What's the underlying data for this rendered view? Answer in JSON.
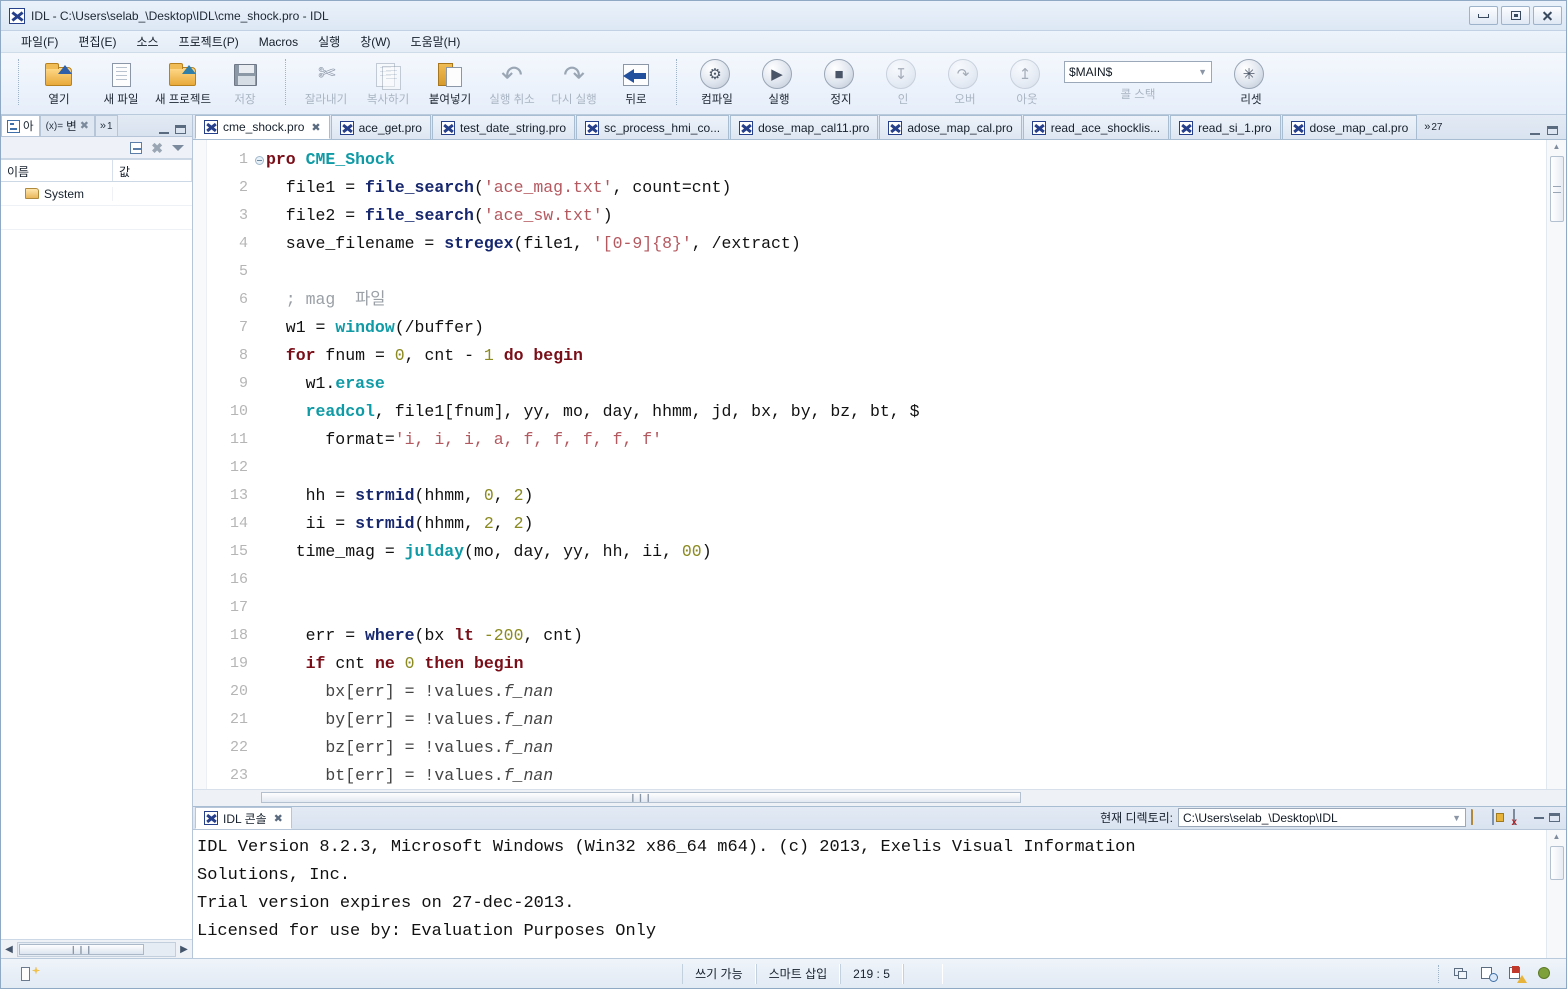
{
  "window": {
    "title": "IDL - C:\\Users\\selab_\\Desktop\\IDL\\cme_shock.pro - IDL",
    "app_icon": "idl-icon",
    "minimize": "minimize-icon",
    "restore": "restore-icon",
    "close": "close-icon"
  },
  "menubar": {
    "items": [
      {
        "label": "파일(F)"
      },
      {
        "label": "편집(E)"
      },
      {
        "label": "소스"
      },
      {
        "label": "프로젝트(P)"
      },
      {
        "label": "Macros"
      },
      {
        "label": "실행"
      },
      {
        "label": "창(W)"
      },
      {
        "label": "도움말(H)"
      }
    ]
  },
  "toolbar": {
    "file_group": [
      {
        "label": "열기",
        "icon": "folder-open-icon",
        "enabled": true
      },
      {
        "label": "새 파일",
        "icon": "new-file-icon",
        "enabled": true
      },
      {
        "label": "새 프로젝트",
        "icon": "new-project-icon",
        "enabled": true
      },
      {
        "label": "저장",
        "icon": "save-icon",
        "enabled": false
      }
    ],
    "edit_group": [
      {
        "label": "잘라내기",
        "icon": "cut-icon",
        "enabled": false
      },
      {
        "label": "복사하기",
        "icon": "copy-icon",
        "enabled": false
      },
      {
        "label": "붙여넣기",
        "icon": "paste-icon",
        "enabled": true
      },
      {
        "label": "실행 취소",
        "icon": "undo-icon",
        "enabled": false
      },
      {
        "label": "다시 실행",
        "icon": "redo-icon",
        "enabled": false
      },
      {
        "label": "뒤로",
        "icon": "back-icon",
        "enabled": true
      }
    ],
    "run_group": [
      {
        "label": "컴파일",
        "icon": "gear-icon",
        "glyph": "⚙",
        "enabled": true
      },
      {
        "label": "실행",
        "icon": "play-icon",
        "glyph": "▶",
        "enabled": true
      },
      {
        "label": "정지",
        "icon": "stop-icon",
        "glyph": "■",
        "enabled": true
      },
      {
        "label": "인",
        "icon": "step-into-icon",
        "glyph": "↧",
        "enabled": false
      },
      {
        "label": "오버",
        "icon": "step-over-icon",
        "glyph": "↷",
        "enabled": false
      },
      {
        "label": "아웃",
        "icon": "step-out-icon",
        "glyph": "↥",
        "enabled": false
      }
    ],
    "callstack": {
      "value": "$MAIN$",
      "label": "콜 스택",
      "dropdown_icon": "chevron-down-icon"
    },
    "reset": {
      "label": "리셋",
      "icon": "reset-icon",
      "glyph": "✳"
    }
  },
  "left_panel": {
    "tabs": [
      {
        "label": "아",
        "icon": "outline-icon",
        "active": true
      },
      {
        "label": "변",
        "icon": "variables-icon",
        "prefix": "(x)=",
        "active": false
      }
    ],
    "overflow": {
      "label": "1",
      "icon": "chevron-double-right-icon"
    },
    "window_controls": {
      "minimize": "minimize-icon",
      "maximize": "maximize-icon"
    },
    "tools": [
      {
        "icon": "collapse-all-icon"
      },
      {
        "icon": "close-icon"
      },
      {
        "icon": "view-menu-icon"
      }
    ],
    "columns": [
      "이름",
      "값"
    ],
    "rows": [
      {
        "name": "System",
        "value": "",
        "icon": "folder-icon"
      }
    ],
    "scrollbar": {
      "left_arrow": "◀",
      "right_arrow": "▶",
      "grip": "❙❙❙"
    }
  },
  "editor_tabs": {
    "tabs": [
      {
        "label": "cme_shock.pro",
        "active": true,
        "closable": true
      },
      {
        "label": "ace_get.pro",
        "active": false,
        "closable": false
      },
      {
        "label": "test_date_string.pro",
        "active": false,
        "closable": false
      },
      {
        "label": "sc_process_hmi_co...",
        "active": false,
        "closable": false
      },
      {
        "label": "dose_map_cal11.pro",
        "active": false,
        "closable": false
      },
      {
        "label": "adose_map_cal.pro",
        "active": false,
        "closable": false
      },
      {
        "label": "read_ace_shocklis...",
        "active": false,
        "closable": false
      },
      {
        "label": "read_si_1.pro",
        "active": false,
        "closable": false
      },
      {
        "label": "dose_map_cal.pro",
        "active": false,
        "closable": false
      }
    ],
    "overflow_count": "27",
    "overflow_icon": "chevron-double-right-icon",
    "window_controls": {
      "minimize": "minimize-icon",
      "maximize": "maximize-icon"
    }
  },
  "editor": {
    "filename": "cme_shock.pro",
    "lines": [
      {
        "n": "1",
        "fold": true,
        "tokens": [
          {
            "t": "pro ",
            "c": "kw"
          },
          {
            "t": "CME_Shock",
            "c": "proc"
          }
        ]
      },
      {
        "n": "2",
        "fold": false,
        "tokens": [
          {
            "t": "  file1 = ",
            "c": ""
          },
          {
            "t": "file_search",
            "c": "fn"
          },
          {
            "t": "(",
            "c": ""
          },
          {
            "t": "'ace_mag.txt'",
            "c": "str"
          },
          {
            "t": ", count=cnt)",
            "c": ""
          }
        ]
      },
      {
        "n": "3",
        "fold": false,
        "tokens": [
          {
            "t": "  file2 = ",
            "c": ""
          },
          {
            "t": "file_search",
            "c": "fn"
          },
          {
            "t": "(",
            "c": ""
          },
          {
            "t": "'ace_sw.txt'",
            "c": "str"
          },
          {
            "t": ")",
            "c": ""
          }
        ]
      },
      {
        "n": "4",
        "fold": false,
        "tokens": [
          {
            "t": "  save_filename = ",
            "c": ""
          },
          {
            "t": "stregex",
            "c": "fn"
          },
          {
            "t": "(file1, ",
            "c": ""
          },
          {
            "t": "'[0-9]{8}'",
            "c": "str"
          },
          {
            "t": ", /extract)",
            "c": ""
          }
        ]
      },
      {
        "n": "5",
        "fold": false,
        "tokens": [
          {
            "t": "",
            "c": ""
          }
        ]
      },
      {
        "n": "6",
        "fold": false,
        "tokens": [
          {
            "t": "  ; mag  파일",
            "c": "cmt"
          }
        ]
      },
      {
        "n": "7",
        "fold": false,
        "tokens": [
          {
            "t": "  w1 = ",
            "c": ""
          },
          {
            "t": "window",
            "c": "bif"
          },
          {
            "t": "(/buffer)",
            "c": ""
          }
        ]
      },
      {
        "n": "8",
        "fold": false,
        "tokens": [
          {
            "t": "  ",
            "c": ""
          },
          {
            "t": "for",
            "c": "kw"
          },
          {
            "t": " fnum = ",
            "c": ""
          },
          {
            "t": "0",
            "c": "num"
          },
          {
            "t": ", cnt - ",
            "c": ""
          },
          {
            "t": "1",
            "c": "num"
          },
          {
            "t": " ",
            "c": ""
          },
          {
            "t": "do begin",
            "c": "kw"
          }
        ]
      },
      {
        "n": "9",
        "fold": false,
        "tokens": [
          {
            "t": "    w1.",
            "c": ""
          },
          {
            "t": "erase",
            "c": "bif"
          }
        ]
      },
      {
        "n": "10",
        "fold": false,
        "tokens": [
          {
            "t": "    ",
            "c": ""
          },
          {
            "t": "readcol",
            "c": "bif"
          },
          {
            "t": ", file1[fnum], yy, mo, day, hhmm, jd, bx, by, bz, bt, $",
            "c": ""
          }
        ]
      },
      {
        "n": "11",
        "fold": false,
        "tokens": [
          {
            "t": "      format=",
            "c": ""
          },
          {
            "t": "'i, i, i, a, f, f, f, f, f'",
            "c": "str"
          }
        ]
      },
      {
        "n": "12",
        "fold": false,
        "tokens": [
          {
            "t": "",
            "c": ""
          }
        ]
      },
      {
        "n": "13",
        "fold": false,
        "tokens": [
          {
            "t": "    hh = ",
            "c": ""
          },
          {
            "t": "strmid",
            "c": "fn"
          },
          {
            "t": "(hhmm, ",
            "c": ""
          },
          {
            "t": "0",
            "c": "num"
          },
          {
            "t": ", ",
            "c": ""
          },
          {
            "t": "2",
            "c": "num"
          },
          {
            "t": ")",
            "c": ""
          }
        ]
      },
      {
        "n": "14",
        "fold": false,
        "tokens": [
          {
            "t": "    ii = ",
            "c": ""
          },
          {
            "t": "strmid",
            "c": "fn"
          },
          {
            "t": "(hhmm, ",
            "c": ""
          },
          {
            "t": "2",
            "c": "num"
          },
          {
            "t": ", ",
            "c": ""
          },
          {
            "t": "2",
            "c": "num"
          },
          {
            "t": ")",
            "c": ""
          }
        ]
      },
      {
        "n": "15",
        "fold": false,
        "tokens": [
          {
            "t": "   time_mag = ",
            "c": ""
          },
          {
            "t": "julday",
            "c": "bif"
          },
          {
            "t": "(mo, day, yy, hh, ii, ",
            "c": ""
          },
          {
            "t": "00",
            "c": "num"
          },
          {
            "t": ")",
            "c": ""
          }
        ]
      },
      {
        "n": "16",
        "fold": false,
        "tokens": [
          {
            "t": "",
            "c": ""
          }
        ]
      },
      {
        "n": "17",
        "fold": false,
        "tokens": [
          {
            "t": "",
            "c": ""
          }
        ]
      },
      {
        "n": "18",
        "fold": false,
        "tokens": [
          {
            "t": "    err = ",
            "c": ""
          },
          {
            "t": "where",
            "c": "fn"
          },
          {
            "t": "(bx ",
            "c": ""
          },
          {
            "t": "lt",
            "c": "kw"
          },
          {
            "t": " ",
            "c": ""
          },
          {
            "t": "-200",
            "c": "num"
          },
          {
            "t": ", cnt)",
            "c": ""
          }
        ]
      },
      {
        "n": "19",
        "fold": false,
        "tokens": [
          {
            "t": "    ",
            "c": ""
          },
          {
            "t": "if",
            "c": "kw"
          },
          {
            "t": " cnt ",
            "c": ""
          },
          {
            "t": "ne",
            "c": "kw"
          },
          {
            "t": " ",
            "c": ""
          },
          {
            "t": "0",
            "c": "num"
          },
          {
            "t": " ",
            "c": ""
          },
          {
            "t": "then begin",
            "c": "kw"
          }
        ]
      },
      {
        "n": "20",
        "fold": false,
        "tokens": [
          {
            "t": "      bx[err] = !values.",
            "c": "sysv"
          },
          {
            "t": "f_nan",
            "c": "sysv ital"
          }
        ]
      },
      {
        "n": "21",
        "fold": false,
        "tokens": [
          {
            "t": "      by[err] = !values.",
            "c": "sysv"
          },
          {
            "t": "f_nan",
            "c": "sysv ital"
          }
        ]
      },
      {
        "n": "22",
        "fold": false,
        "tokens": [
          {
            "t": "      bz[err] = !values.",
            "c": "sysv"
          },
          {
            "t": "f_nan",
            "c": "sysv ital"
          }
        ]
      },
      {
        "n": "23",
        "fold": false,
        "tokens": [
          {
            "t": "      bt[err] = !values.",
            "c": "sysv"
          },
          {
            "t": "f_nan",
            "c": "sysv ital"
          }
        ]
      }
    ],
    "vscroll": {
      "up_arrow": "▲"
    },
    "hscroll": {
      "grip": "❙❙❙"
    }
  },
  "console": {
    "tab_label": "IDL 콘솔",
    "tab_icon": "idl-icon",
    "tab_close": "close-icon",
    "dir_label": "현재 디렉토리:",
    "dir_value": "C:\\Users\\selab_\\Desktop\\IDL",
    "dir_dropdown_icon": "chevron-down-icon",
    "buttons": [
      {
        "icon": "open-folder-icon"
      },
      {
        "icon": "lock-scroll-icon"
      },
      {
        "icon": "clear-console-icon"
      }
    ],
    "window_controls": {
      "minimize": "minimize-icon",
      "maximize": "maximize-icon"
    },
    "output": "IDL Version 8.2.3, Microsoft Windows (Win32 x86_64 m64). (c) 2013, Exelis Visual Information\nSolutions, Inc.\nTrial version expires on 27-dec-2013.\nLicensed for use by: Evaluation Purposes Only"
  },
  "statusbar": {
    "left_icon": "writable-doc-icon",
    "sections": [
      {
        "label": "쓰기 가능"
      },
      {
        "label": "스마트 삽입"
      },
      {
        "label": "219 : 5"
      }
    ],
    "right_icons": [
      {
        "icon": "tile-windows-icon"
      },
      {
        "icon": "build-history-icon"
      },
      {
        "icon": "problems-icon"
      },
      {
        "icon": "debug-icon"
      }
    ]
  },
  "colors": {
    "keyword": "#7a0e18",
    "function": "#16276e",
    "builtin": "#0f9ba6",
    "string": "#b4585f",
    "number": "#8a8a20",
    "comment": "#9aa0a6",
    "chrome": "#dde8f5",
    "editor_bg": "#ffffff"
  }
}
